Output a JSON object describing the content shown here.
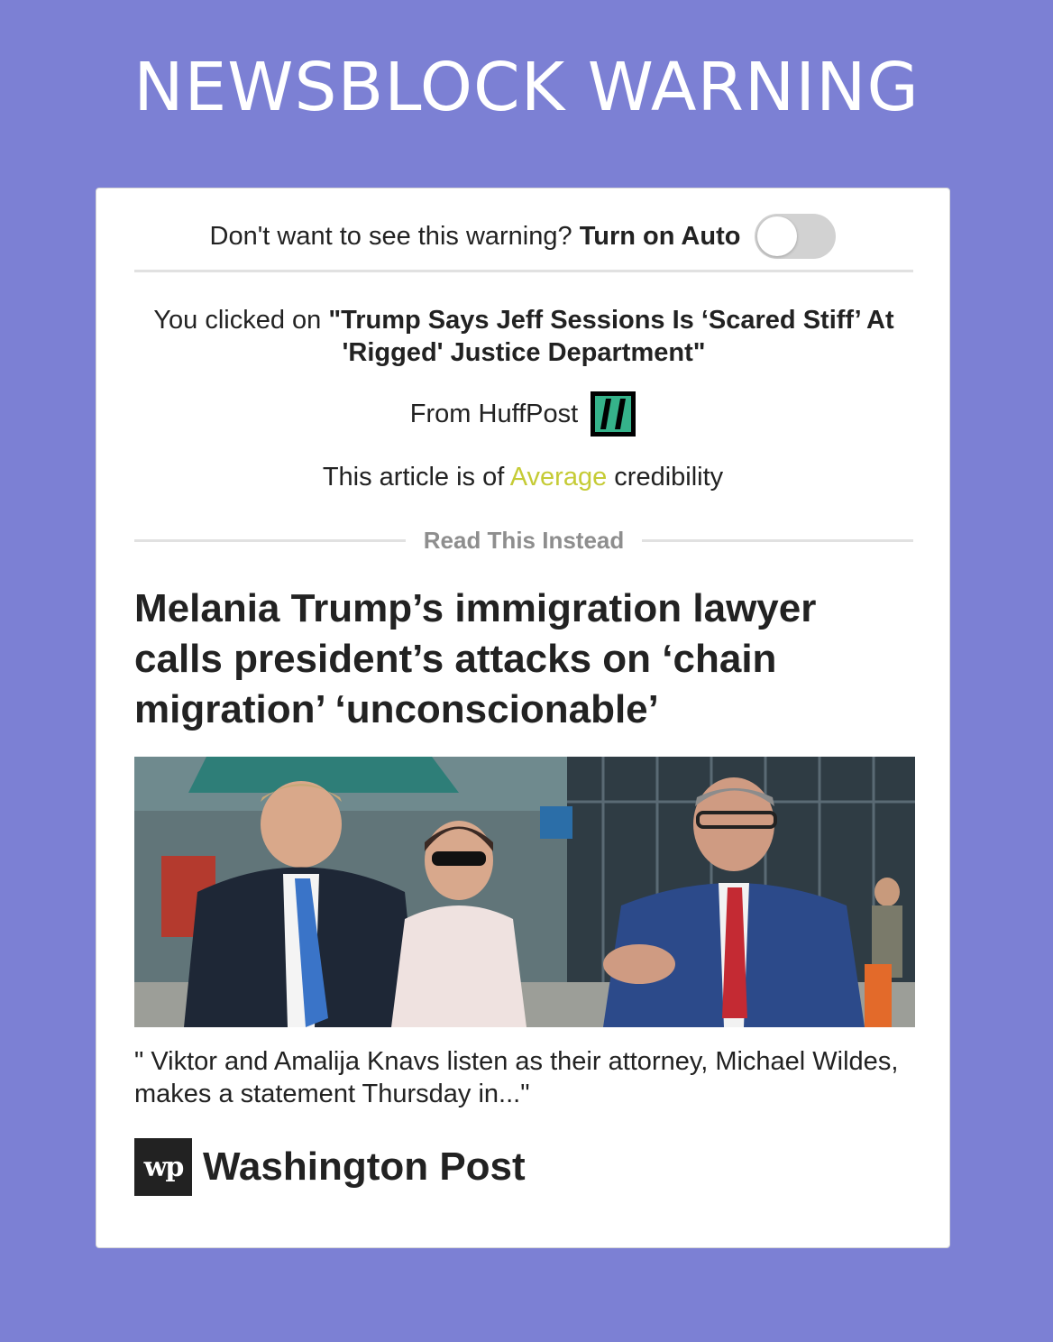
{
  "header": {
    "title": "NEWSBLOCK WARNING"
  },
  "auto": {
    "prompt": "Don't want to see this warning?",
    "action": "Turn on Auto",
    "enabled": false
  },
  "clicked": {
    "prefix": "You clicked on",
    "article_title": "\"Trump Says Jeff Sessions Is ‘Scared Stiff’ At 'Rigged' Justice Department\""
  },
  "source": {
    "prefix": "From",
    "name": "HuffPost",
    "logo_icon": "huffpost-logo-icon"
  },
  "credibility": {
    "prefix": "This article is of",
    "level": "Average",
    "suffix": "credibility",
    "level_color": "#c5cb35"
  },
  "alternative": {
    "section_label": "Read This Instead",
    "headline": "Melania Trump’s immigration lawyer calls president’s attacks on ‘chain migration’ ‘unconscionable’",
    "caption": "\" Viktor and Amalija Knavs listen as their attorney, Michael Wildes, makes a statement Thursday in...\"",
    "source_name": "Washington Post",
    "source_logo_icon": "washington-post-logo-icon",
    "source_logo_text": "wp"
  },
  "colors": {
    "background": "#7c80d4",
    "accent_average": "#c5cb35"
  }
}
